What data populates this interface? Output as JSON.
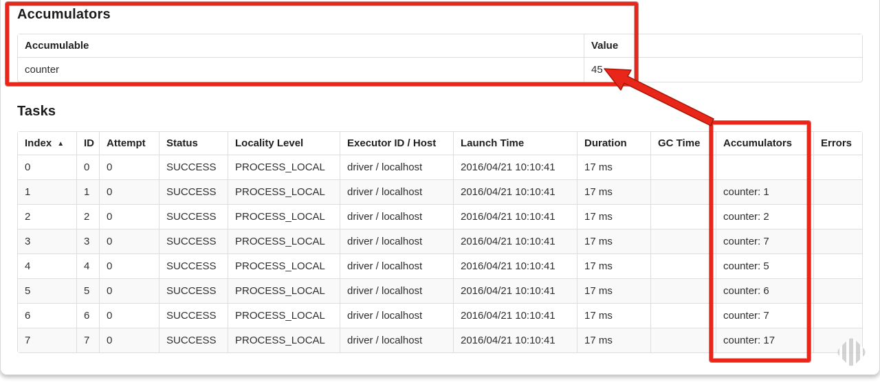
{
  "annotations": {
    "color": "#e8261a",
    "outline_color": "#a81507",
    "arrow_points_to": "45"
  },
  "icons": {
    "sort_ascending": "▲",
    "watermark": "striped-diamond-stamp"
  },
  "accumulators_section": {
    "title": "Accumulators",
    "table": {
      "headers": {
        "accumulable": "Accumulable",
        "value": "Value"
      },
      "rows": [
        {
          "accumulable": "counter",
          "value": "45"
        }
      ]
    }
  },
  "tasks_section": {
    "title": "Tasks",
    "table": {
      "headers": {
        "index": "Index",
        "id": "ID",
        "attempt": "Attempt",
        "status": "Status",
        "locality": "Locality Level",
        "executor": "Executor ID / Host",
        "launch": "Launch Time",
        "duration": "Duration",
        "gc_time": "GC Time",
        "accumulators": "Accumulators",
        "errors": "Errors"
      },
      "rows": [
        {
          "index": "0",
          "id": "0",
          "attempt": "0",
          "status": "SUCCESS",
          "locality": "PROCESS_LOCAL",
          "executor": "driver / localhost",
          "launch": "2016/04/21 10:10:41",
          "duration": "17 ms",
          "gc_time": "",
          "accumulators": "",
          "errors": ""
        },
        {
          "index": "1",
          "id": "1",
          "attempt": "0",
          "status": "SUCCESS",
          "locality": "PROCESS_LOCAL",
          "executor": "driver / localhost",
          "launch": "2016/04/21 10:10:41",
          "duration": "17 ms",
          "gc_time": "",
          "accumulators": "counter: 1",
          "errors": ""
        },
        {
          "index": "2",
          "id": "2",
          "attempt": "0",
          "status": "SUCCESS",
          "locality": "PROCESS_LOCAL",
          "executor": "driver / localhost",
          "launch": "2016/04/21 10:10:41",
          "duration": "17 ms",
          "gc_time": "",
          "accumulators": "counter: 2",
          "errors": ""
        },
        {
          "index": "3",
          "id": "3",
          "attempt": "0",
          "status": "SUCCESS",
          "locality": "PROCESS_LOCAL",
          "executor": "driver / localhost",
          "launch": "2016/04/21 10:10:41",
          "duration": "17 ms",
          "gc_time": "",
          "accumulators": "counter: 7",
          "errors": ""
        },
        {
          "index": "4",
          "id": "4",
          "attempt": "0",
          "status": "SUCCESS",
          "locality": "PROCESS_LOCAL",
          "executor": "driver / localhost",
          "launch": "2016/04/21 10:10:41",
          "duration": "17 ms",
          "gc_time": "",
          "accumulators": "counter: 5",
          "errors": ""
        },
        {
          "index": "5",
          "id": "5",
          "attempt": "0",
          "status": "SUCCESS",
          "locality": "PROCESS_LOCAL",
          "executor": "driver / localhost",
          "launch": "2016/04/21 10:10:41",
          "duration": "17 ms",
          "gc_time": "",
          "accumulators": "counter: 6",
          "errors": ""
        },
        {
          "index": "6",
          "id": "6",
          "attempt": "0",
          "status": "SUCCESS",
          "locality": "PROCESS_LOCAL",
          "executor": "driver / localhost",
          "launch": "2016/04/21 10:10:41",
          "duration": "17 ms",
          "gc_time": "",
          "accumulators": "counter: 7",
          "errors": ""
        },
        {
          "index": "7",
          "id": "7",
          "attempt": "0",
          "status": "SUCCESS",
          "locality": "PROCESS_LOCAL",
          "executor": "driver / localhost",
          "launch": "2016/04/21 10:10:41",
          "duration": "17 ms",
          "gc_time": "",
          "accumulators": "counter: 17",
          "errors": ""
        }
      ]
    }
  }
}
